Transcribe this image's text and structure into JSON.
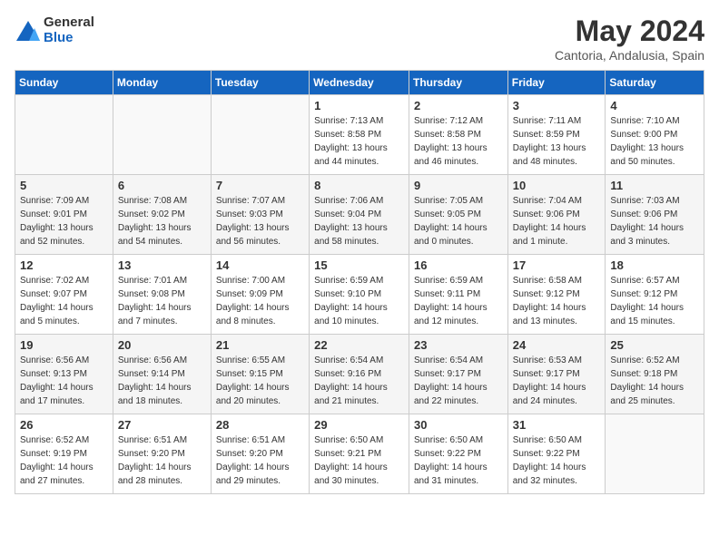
{
  "header": {
    "logo_line1": "General",
    "logo_line2": "Blue",
    "month_title": "May 2024",
    "subtitle": "Cantoria, Andalusia, Spain"
  },
  "weekdays": [
    "Sunday",
    "Monday",
    "Tuesday",
    "Wednesday",
    "Thursday",
    "Friday",
    "Saturday"
  ],
  "weeks": [
    [
      {
        "day": "",
        "info": ""
      },
      {
        "day": "",
        "info": ""
      },
      {
        "day": "",
        "info": ""
      },
      {
        "day": "1",
        "info": "Sunrise: 7:13 AM\nSunset: 8:58 PM\nDaylight: 13 hours\nand 44 minutes."
      },
      {
        "day": "2",
        "info": "Sunrise: 7:12 AM\nSunset: 8:58 PM\nDaylight: 13 hours\nand 46 minutes."
      },
      {
        "day": "3",
        "info": "Sunrise: 7:11 AM\nSunset: 8:59 PM\nDaylight: 13 hours\nand 48 minutes."
      },
      {
        "day": "4",
        "info": "Sunrise: 7:10 AM\nSunset: 9:00 PM\nDaylight: 13 hours\nand 50 minutes."
      }
    ],
    [
      {
        "day": "5",
        "info": "Sunrise: 7:09 AM\nSunset: 9:01 PM\nDaylight: 13 hours\nand 52 minutes."
      },
      {
        "day": "6",
        "info": "Sunrise: 7:08 AM\nSunset: 9:02 PM\nDaylight: 13 hours\nand 54 minutes."
      },
      {
        "day": "7",
        "info": "Sunrise: 7:07 AM\nSunset: 9:03 PM\nDaylight: 13 hours\nand 56 minutes."
      },
      {
        "day": "8",
        "info": "Sunrise: 7:06 AM\nSunset: 9:04 PM\nDaylight: 13 hours\nand 58 minutes."
      },
      {
        "day": "9",
        "info": "Sunrise: 7:05 AM\nSunset: 9:05 PM\nDaylight: 14 hours\nand 0 minutes."
      },
      {
        "day": "10",
        "info": "Sunrise: 7:04 AM\nSunset: 9:06 PM\nDaylight: 14 hours\nand 1 minute."
      },
      {
        "day": "11",
        "info": "Sunrise: 7:03 AM\nSunset: 9:06 PM\nDaylight: 14 hours\nand 3 minutes."
      }
    ],
    [
      {
        "day": "12",
        "info": "Sunrise: 7:02 AM\nSunset: 9:07 PM\nDaylight: 14 hours\nand 5 minutes."
      },
      {
        "day": "13",
        "info": "Sunrise: 7:01 AM\nSunset: 9:08 PM\nDaylight: 14 hours\nand 7 minutes."
      },
      {
        "day": "14",
        "info": "Sunrise: 7:00 AM\nSunset: 9:09 PM\nDaylight: 14 hours\nand 8 minutes."
      },
      {
        "day": "15",
        "info": "Sunrise: 6:59 AM\nSunset: 9:10 PM\nDaylight: 14 hours\nand 10 minutes."
      },
      {
        "day": "16",
        "info": "Sunrise: 6:59 AM\nSunset: 9:11 PM\nDaylight: 14 hours\nand 12 minutes."
      },
      {
        "day": "17",
        "info": "Sunrise: 6:58 AM\nSunset: 9:12 PM\nDaylight: 14 hours\nand 13 minutes."
      },
      {
        "day": "18",
        "info": "Sunrise: 6:57 AM\nSunset: 9:12 PM\nDaylight: 14 hours\nand 15 minutes."
      }
    ],
    [
      {
        "day": "19",
        "info": "Sunrise: 6:56 AM\nSunset: 9:13 PM\nDaylight: 14 hours\nand 17 minutes."
      },
      {
        "day": "20",
        "info": "Sunrise: 6:56 AM\nSunset: 9:14 PM\nDaylight: 14 hours\nand 18 minutes."
      },
      {
        "day": "21",
        "info": "Sunrise: 6:55 AM\nSunset: 9:15 PM\nDaylight: 14 hours\nand 20 minutes."
      },
      {
        "day": "22",
        "info": "Sunrise: 6:54 AM\nSunset: 9:16 PM\nDaylight: 14 hours\nand 21 minutes."
      },
      {
        "day": "23",
        "info": "Sunrise: 6:54 AM\nSunset: 9:17 PM\nDaylight: 14 hours\nand 22 minutes."
      },
      {
        "day": "24",
        "info": "Sunrise: 6:53 AM\nSunset: 9:17 PM\nDaylight: 14 hours\nand 24 minutes."
      },
      {
        "day": "25",
        "info": "Sunrise: 6:52 AM\nSunset: 9:18 PM\nDaylight: 14 hours\nand 25 minutes."
      }
    ],
    [
      {
        "day": "26",
        "info": "Sunrise: 6:52 AM\nSunset: 9:19 PM\nDaylight: 14 hours\nand 27 minutes."
      },
      {
        "day": "27",
        "info": "Sunrise: 6:51 AM\nSunset: 9:20 PM\nDaylight: 14 hours\nand 28 minutes."
      },
      {
        "day": "28",
        "info": "Sunrise: 6:51 AM\nSunset: 9:20 PM\nDaylight: 14 hours\nand 29 minutes."
      },
      {
        "day": "29",
        "info": "Sunrise: 6:50 AM\nSunset: 9:21 PM\nDaylight: 14 hours\nand 30 minutes."
      },
      {
        "day": "30",
        "info": "Sunrise: 6:50 AM\nSunset: 9:22 PM\nDaylight: 14 hours\nand 31 minutes."
      },
      {
        "day": "31",
        "info": "Sunrise: 6:50 AM\nSunset: 9:22 PM\nDaylight: 14 hours\nand 32 minutes."
      },
      {
        "day": "",
        "info": ""
      }
    ]
  ]
}
